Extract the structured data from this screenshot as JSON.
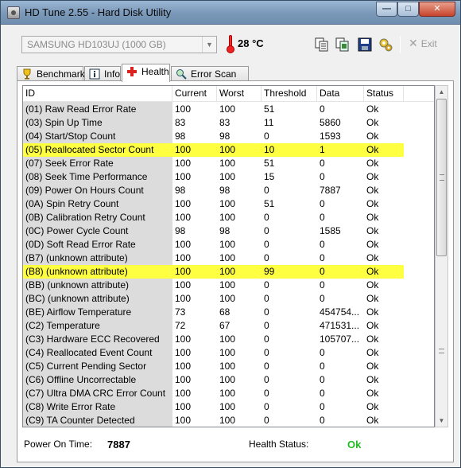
{
  "window": {
    "title": "HD Tune 2.55 - Hard Disk Utility",
    "min_glyph": "—",
    "max_glyph": "□",
    "close_glyph": "✕"
  },
  "toolbar": {
    "disk": "SAMSUNG HD103UJ (1000 GB)",
    "temperature": "28 °C",
    "exit_label": "Exit"
  },
  "tabs": [
    {
      "label": "Benchmark",
      "icon": "trophy-icon"
    },
    {
      "label": "Info",
      "icon": "info-icon"
    },
    {
      "label": "Health",
      "icon": "health-cross-icon",
      "active": true
    },
    {
      "label": "Error Scan",
      "icon": "magnifier-icon"
    }
  ],
  "table": {
    "columns": [
      "ID",
      "Current",
      "Worst",
      "Threshold",
      "Data",
      "Status"
    ],
    "rows": [
      {
        "id": "(01) Raw Read Error Rate",
        "current": "100",
        "worst": "100",
        "threshold": "51",
        "data": "0",
        "status": "Ok"
      },
      {
        "id": "(03) Spin Up Time",
        "current": "83",
        "worst": "83",
        "threshold": "11",
        "data": "5860",
        "status": "Ok"
      },
      {
        "id": "(04) Start/Stop Count",
        "current": "98",
        "worst": "98",
        "threshold": "0",
        "data": "1593",
        "status": "Ok"
      },
      {
        "id": "(05) Reallocated Sector Count",
        "current": "100",
        "worst": "100",
        "threshold": "10",
        "data": "1",
        "status": "Ok",
        "highlight": true
      },
      {
        "id": "(07) Seek Error Rate",
        "current": "100",
        "worst": "100",
        "threshold": "51",
        "data": "0",
        "status": "Ok"
      },
      {
        "id": "(08) Seek Time Performance",
        "current": "100",
        "worst": "100",
        "threshold": "15",
        "data": "0",
        "status": "Ok"
      },
      {
        "id": "(09) Power On Hours Count",
        "current": "98",
        "worst": "98",
        "threshold": "0",
        "data": "7887",
        "status": "Ok"
      },
      {
        "id": "(0A) Spin Retry Count",
        "current": "100",
        "worst": "100",
        "threshold": "51",
        "data": "0",
        "status": "Ok"
      },
      {
        "id": "(0B) Calibration Retry Count",
        "current": "100",
        "worst": "100",
        "threshold": "0",
        "data": "0",
        "status": "Ok"
      },
      {
        "id": "(0C) Power Cycle Count",
        "current": "98",
        "worst": "98",
        "threshold": "0",
        "data": "1585",
        "status": "Ok"
      },
      {
        "id": "(0D) Soft Read Error Rate",
        "current": "100",
        "worst": "100",
        "threshold": "0",
        "data": "0",
        "status": "Ok"
      },
      {
        "id": "(B7) (unknown attribute)",
        "current": "100",
        "worst": "100",
        "threshold": "0",
        "data": "0",
        "status": "Ok"
      },
      {
        "id": "(B8) (unknown attribute)",
        "current": "100",
        "worst": "100",
        "threshold": "99",
        "data": "0",
        "status": "Ok",
        "highlight": true
      },
      {
        "id": "(BB) (unknown attribute)",
        "current": "100",
        "worst": "100",
        "threshold": "0",
        "data": "0",
        "status": "Ok"
      },
      {
        "id": "(BC) (unknown attribute)",
        "current": "100",
        "worst": "100",
        "threshold": "0",
        "data": "0",
        "status": "Ok"
      },
      {
        "id": "(BE) Airflow Temperature",
        "current": "73",
        "worst": "68",
        "threshold": "0",
        "data": "454754...",
        "status": "Ok"
      },
      {
        "id": "(C2) Temperature",
        "current": "72",
        "worst": "67",
        "threshold": "0",
        "data": "471531...",
        "status": "Ok"
      },
      {
        "id": "(C3) Hardware ECC Recovered",
        "current": "100",
        "worst": "100",
        "threshold": "0",
        "data": "105707...",
        "status": "Ok"
      },
      {
        "id": "(C4) Reallocated Event Count",
        "current": "100",
        "worst": "100",
        "threshold": "0",
        "data": "0",
        "status": "Ok"
      },
      {
        "id": "(C5) Current Pending Sector",
        "current": "100",
        "worst": "100",
        "threshold": "0",
        "data": "0",
        "status": "Ok"
      },
      {
        "id": "(C6) Offline Uncorrectable",
        "current": "100",
        "worst": "100",
        "threshold": "0",
        "data": "0",
        "status": "Ok"
      },
      {
        "id": "(C7) Ultra DMA CRC Error Count",
        "current": "100",
        "worst": "100",
        "threshold": "0",
        "data": "0",
        "status": "Ok"
      },
      {
        "id": "(C8) Write Error Rate",
        "current": "100",
        "worst": "100",
        "threshold": "0",
        "data": "0",
        "status": "Ok"
      },
      {
        "id": "(C9) TA Counter Detected",
        "current": "100",
        "worst": "100",
        "threshold": "0",
        "data": "0",
        "status": "Ok"
      }
    ]
  },
  "footer": {
    "power_on_label": "Power On Time:",
    "power_on_value": "7887",
    "health_label": "Health Status:",
    "health_value": "Ok"
  },
  "colors": {
    "highlight": "#ffff41",
    "health_ok": "#22bb22",
    "id_column_bg": "#dcdcdc"
  }
}
